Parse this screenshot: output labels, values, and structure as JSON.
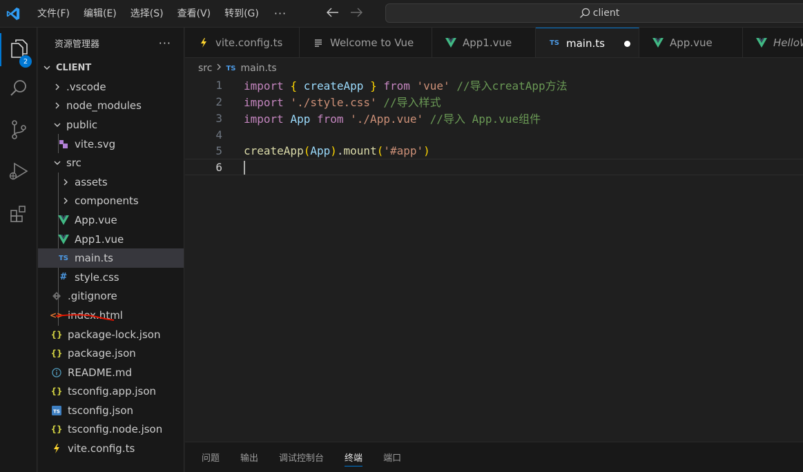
{
  "menu": {
    "items": [
      "文件(F)",
      "编辑(E)",
      "选择(S)",
      "查看(V)",
      "转到(G)"
    ],
    "more": "···"
  },
  "search": {
    "text": "client"
  },
  "activity": {
    "explorer_badge": "2"
  },
  "sidebar": {
    "title": "资源管理器",
    "more": "···",
    "root": "CLIENT",
    "items": [
      {
        "label": ".vscode",
        "kind": "folder-collapsed"
      },
      {
        "label": "node_modules",
        "kind": "folder-collapsed"
      },
      {
        "label": "public",
        "kind": "folder-expanded"
      },
      {
        "label": "vite.svg",
        "kind": "svg-file"
      },
      {
        "label": "src",
        "kind": "folder-expanded"
      },
      {
        "label": "assets",
        "kind": "folder-collapsed"
      },
      {
        "label": "components",
        "kind": "folder-collapsed"
      },
      {
        "label": "App.vue",
        "kind": "vue-file"
      },
      {
        "label": "App1.vue",
        "kind": "vue-file"
      },
      {
        "label": "main.ts",
        "kind": "ts-file",
        "selected": true
      },
      {
        "label": "style.css",
        "kind": "css-file"
      },
      {
        "label": ".gitignore",
        "kind": "git-file"
      },
      {
        "label": "index.html",
        "kind": "html-file"
      },
      {
        "label": "package-lock.json",
        "kind": "json-file"
      },
      {
        "label": "package.json",
        "kind": "json-file"
      },
      {
        "label": "README.md",
        "kind": "info-file"
      },
      {
        "label": "tsconfig.app.json",
        "kind": "json-file"
      },
      {
        "label": "tsconfig.json",
        "kind": "tsconfig-file"
      },
      {
        "label": "tsconfig.node.json",
        "kind": "json-file"
      },
      {
        "label": "vite.config.ts",
        "kind": "vite-file"
      }
    ]
  },
  "tabs": [
    {
      "label": "vite.config.ts",
      "icon": "vite-icon"
    },
    {
      "label": "Welcome to Vue",
      "icon": "preview-icon"
    },
    {
      "label": "App1.vue",
      "icon": "vue-icon"
    },
    {
      "label": "main.ts",
      "icon": "ts-icon",
      "active": true,
      "modified": true
    },
    {
      "label": "App.vue",
      "icon": "vue-icon"
    },
    {
      "label": "HelloW",
      "icon": "vue-icon",
      "italic": true
    }
  ],
  "breadcrumb": {
    "folder": "src",
    "file": "main.ts",
    "file_icon": "TS"
  },
  "editor": {
    "line_numbers": [
      "1",
      "2",
      "3",
      "4",
      "5",
      "6"
    ],
    "line1": {
      "kw1": "import",
      "b1": "{",
      "name": "createApp",
      "b2": "}",
      "kw2": "from",
      "str": "'vue'",
      "comment": "//导入creatApp方法"
    },
    "line2": {
      "kw1": "import",
      "str": "'./style.css'",
      "comment": "//导入样式"
    },
    "line3": {
      "kw1": "import",
      "name": "App",
      "kw2": "from",
      "str": "'./App.vue'",
      "comment": "//导入 App.vue组件"
    },
    "line5": {
      "fn": "createApp",
      "p1": "(",
      "arg": "App",
      "p2": ")",
      "dot": ".",
      "method": "mount",
      "p3": "(",
      "str": "'#app'",
      "p4": ")"
    }
  },
  "panel": {
    "tabs": [
      "问题",
      "输出",
      "调试控制台",
      "终端",
      "端口"
    ],
    "active": "终端"
  },
  "colors": {
    "accent": "#0078d4",
    "vue_green": "#41b883",
    "ts_blue": "#4d9be6",
    "annotation_red": "#e51400"
  }
}
